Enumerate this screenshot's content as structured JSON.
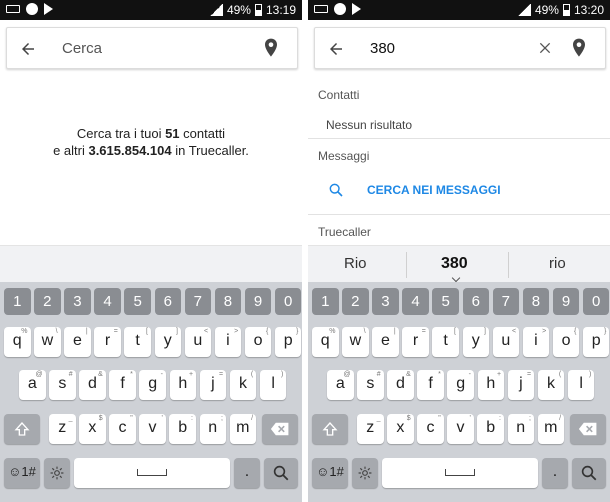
{
  "colors": {
    "accent": "#1e88e5",
    "keyboard_bg": "#ced1d6",
    "num_key": "#8a8d92"
  },
  "left": {
    "status": {
      "battery": "49%",
      "time": "13:19"
    },
    "search": {
      "placeholder": "Cerca",
      "value": ""
    },
    "info": {
      "line1_prefix": "Cerca tra i tuoi ",
      "contacts_count": "51",
      "line1_suffix": " contatti",
      "line2_prefix": "e altri ",
      "truecaller_count": "3.615.854.104",
      "line2_suffix": " in Truecaller."
    }
  },
  "right": {
    "status": {
      "battery": "49%",
      "time": "13:20"
    },
    "search": {
      "placeholder": "Cerca",
      "value": "380"
    },
    "results": {
      "contacts_label": "Contatti",
      "no_results": "Nessun risultato",
      "messages_label": "Messaggi",
      "search_messages": "CERCA NEI MESSAGGI",
      "truecaller_label": "Truecaller"
    },
    "suggestions": [
      "Rio",
      "380",
      "rio"
    ]
  },
  "icons": {
    "back": "arrow-left-icon",
    "pin": "location-pin-icon",
    "clear": "close-icon",
    "search": "magnifier-icon",
    "shift": "shift-icon",
    "backspace": "backspace-icon",
    "settings": "gear-icon"
  },
  "keyboard": {
    "numbers": [
      "1",
      "2",
      "3",
      "4",
      "5",
      "6",
      "7",
      "8",
      "9",
      "0"
    ],
    "row1": [
      "q",
      "w",
      "e",
      "r",
      "t",
      "y",
      "u",
      "i",
      "o",
      "p"
    ],
    "row1_sub": [
      "%",
      "\\",
      "|",
      "=",
      "[",
      "]",
      "<",
      ">",
      "{",
      "}"
    ],
    "row2": [
      "a",
      "s",
      "d",
      "f",
      "g",
      "h",
      "j",
      "k",
      "l"
    ],
    "row2_sub": [
      "@",
      "#",
      "&",
      "*",
      "-",
      "+",
      "=",
      "(",
      ")"
    ],
    "row3": [
      "z",
      "x",
      "c",
      "v",
      "b",
      "n",
      "m"
    ],
    "row3_sub": [
      "_",
      "$",
      "\"",
      "'",
      ":",
      ";",
      "/"
    ],
    "symbols_key": "☺1#",
    "period": "."
  }
}
